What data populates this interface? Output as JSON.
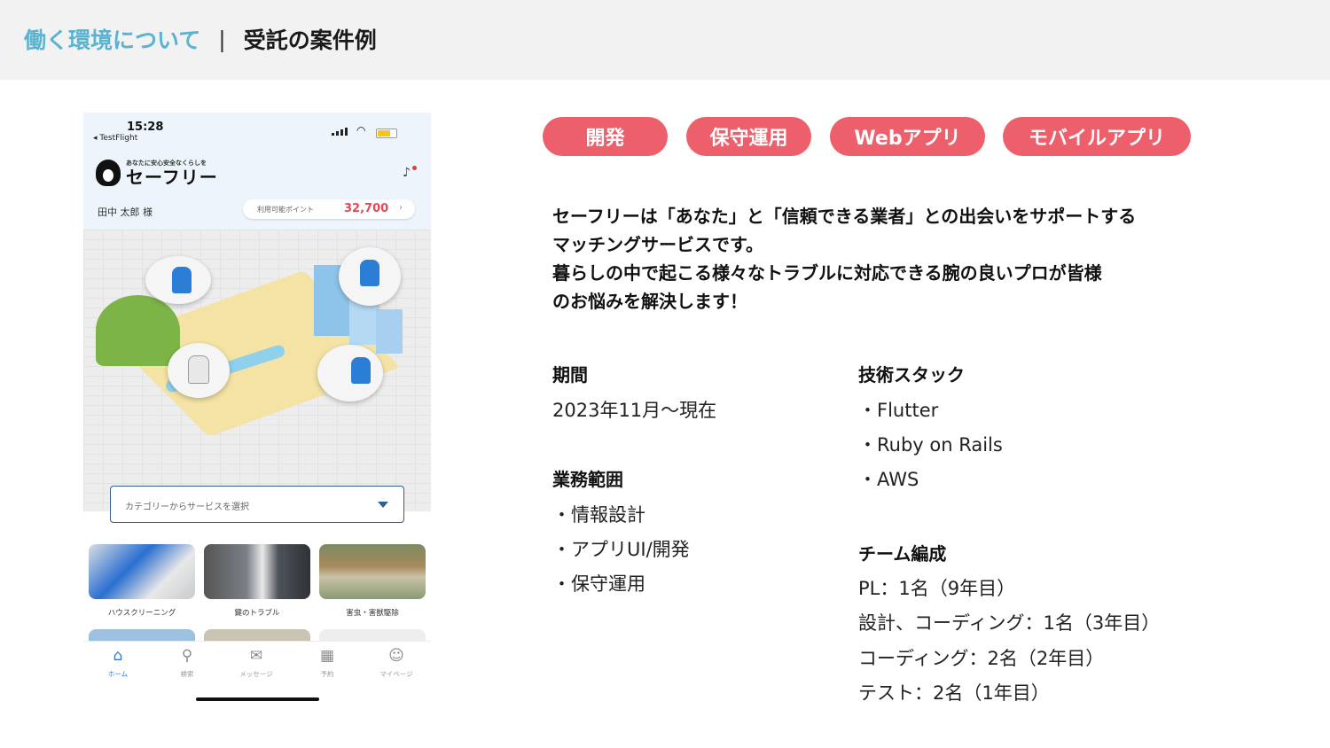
{
  "header": {
    "section": "働く環境について",
    "separator": "|",
    "subtitle": "受託の案件例"
  },
  "phone": {
    "status": {
      "time": "15:28",
      "back_label": "◂ TestFlight",
      "wifi_icon": "wifi-icon"
    },
    "app": {
      "tagline": "あなたに安心安全なくらしを",
      "brand": "セーフリー",
      "user_name": "田中 太郎 様",
      "points_label": "利用可能ポイント",
      "points_value": "32,700",
      "points_arrow": "›"
    },
    "select_placeholder": "カテゴリーからサービスを選択",
    "categories": [
      {
        "label": "ハウスクリーニング"
      },
      {
        "label": "鍵のトラブル"
      },
      {
        "label": "害虫・害獣駆除"
      }
    ],
    "tabs": [
      {
        "label": "ホーム",
        "icon": "home-icon",
        "glyph": "⌂"
      },
      {
        "label": "検索",
        "icon": "search-icon",
        "glyph": "⚲"
      },
      {
        "label": "メッセージ",
        "icon": "message-icon",
        "glyph": "✉"
      },
      {
        "label": "予約",
        "icon": "calendar-icon",
        "glyph": "▦"
      },
      {
        "label": "マイページ",
        "icon": "user-icon",
        "glyph": "☺"
      }
    ]
  },
  "tags": [
    "開発",
    "保守運用",
    "Webアプリ",
    "モバイルアプリ"
  ],
  "description": [
    "セーフリーは「あなた」と「信頼できる業者」との出会いをサポートする",
    "マッチングサービスです。",
    "暮らしの中で起こる様々なトラブルに対応できる腕の良いプロが皆様",
    "のお悩みを解決します！"
  ],
  "period": {
    "heading": "期間",
    "value": "2023年11月〜現在"
  },
  "scope": {
    "heading": "業務範囲",
    "items": [
      "・情報設計",
      "・アプリUI/開発",
      "・保守運用"
    ]
  },
  "tech": {
    "heading": "技術スタック",
    "items": [
      "・Flutter",
      "・Ruby on Rails",
      "・AWS"
    ]
  },
  "team": {
    "heading": "チーム編成",
    "items": [
      "PL：1名（9年目）",
      "設計、コーディング：1名（3年目）",
      "コーディング：2名（2年目）",
      "テスト：2名（1年目）"
    ]
  },
  "colors": {
    "accent": "#5bb3cf",
    "tag": "#ee5f6c",
    "points": "#e24a58",
    "tab_active": "#2b78d8"
  }
}
